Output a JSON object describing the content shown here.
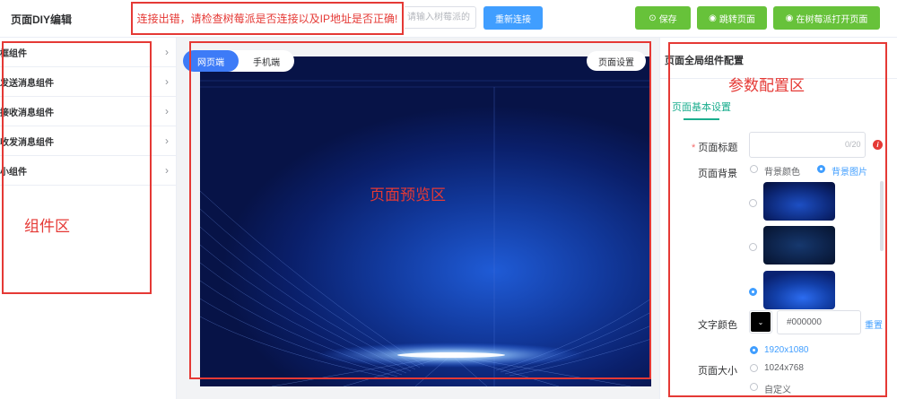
{
  "header": {
    "app_title": "页面DIY编辑",
    "alert_text": "连接出错，请检查树莓派是否连接以及IP地址是否正确!",
    "ip_placeholder": "请输入树莓派的",
    "reconnect_label": "重新连接",
    "save_label": "保存",
    "jump_label": "跳转页面",
    "open_on_pi_label": "在树莓派打开页面"
  },
  "components": {
    "items": [
      {
        "label": "框组件"
      },
      {
        "label": "发送消息组件"
      },
      {
        "label": "接收消息组件"
      },
      {
        "label": "收发消息组件"
      },
      {
        "label": "小组件"
      }
    ],
    "zone_label": "组件区"
  },
  "preview": {
    "tabs": [
      {
        "label": "网页端"
      },
      {
        "label": "手机端"
      }
    ],
    "page_settings_label": "页面设置",
    "zone_label": "页面预览区"
  },
  "config": {
    "title": "页面全局组件配置",
    "zone_label": "参数配置区",
    "tab_label": "页面基本设置",
    "page_title_label": "页面标题",
    "page_title_required_mark": "*",
    "page_title_count": "0/20",
    "background_label": "页面背景",
    "bg_color_option": "背景颜色",
    "bg_image_option": "背景图片",
    "text_color_label": "文字颜色",
    "text_color_value": "#000000",
    "reset_label": "重置",
    "page_size_label": "页面大小",
    "size_options": [
      {
        "label": "1920x1080"
      },
      {
        "label": "1024x768"
      },
      {
        "label": "自定义"
      }
    ]
  },
  "colors": {
    "accent_blue": "#409eff",
    "accent_green": "#67c23a",
    "teal": "#1aad8e",
    "alert_red": "#e53935"
  },
  "icons": {
    "save": "check-circle-icon",
    "jump": "eye-icon",
    "open": "eye-icon",
    "chevron": "chevron-right-icon",
    "info": "info-icon"
  }
}
